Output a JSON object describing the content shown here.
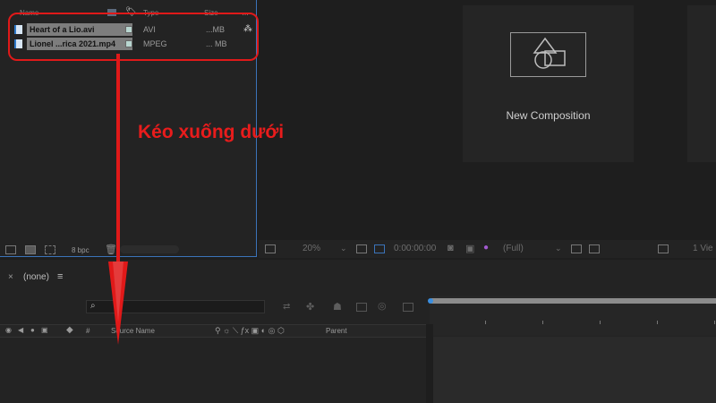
{
  "project": {
    "columns": {
      "name": "Name",
      "type": "Type",
      "size": "Size"
    },
    "items": [
      {
        "name": "Heart of a Lio.avi",
        "type": "AVI",
        "size": "...MB"
      },
      {
        "name": "Lionel ...rica 2021.mp4",
        "type": "MPEG",
        "size": "... MB"
      }
    ],
    "bpc": "8 bpc"
  },
  "viewer": {
    "new_composition": "New Composition",
    "zoom": "20%",
    "timecode": "0:00:00:00",
    "resolution": "(Full)",
    "views": "1 Vie"
  },
  "timeline": {
    "tab_label": "(none)",
    "layer_header": {
      "hash": "#",
      "source_name": "Source Name",
      "parent": "Parent"
    }
  },
  "annotation": {
    "text": "Kéo xuống dưới",
    "color": "#e91c1c"
  }
}
